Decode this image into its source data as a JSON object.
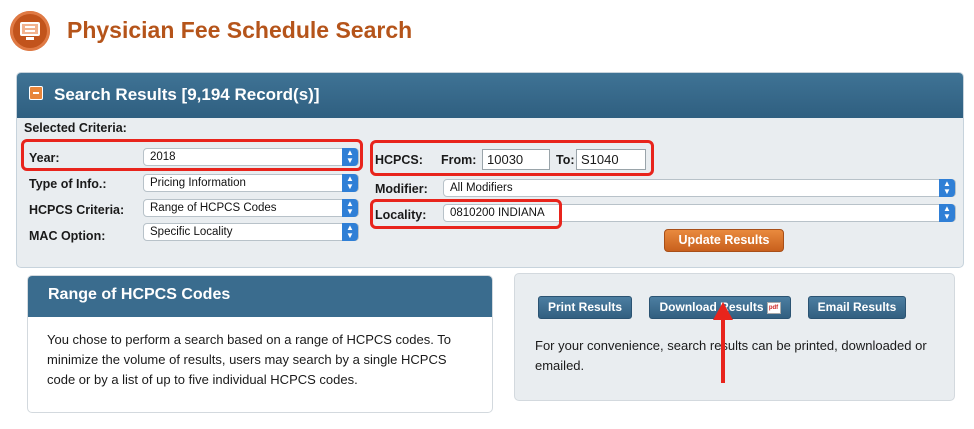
{
  "header": {
    "title": "Physician Fee Schedule Search",
    "logo_icon": "monitor-icon",
    "brand_color": "#b5541a"
  },
  "results": {
    "title": "Search Results [9,194 Record(s)]",
    "collapse_icon": "minus-icon",
    "selected_criteria_label": "Selected Criteria:",
    "year_label": "Year:",
    "year_value": "2018",
    "type_label": "Type of Info.:",
    "type_value": "Pricing Information",
    "hcpcs_criteria_label": "HCPCS Criteria:",
    "hcpcs_criteria_value": "Range of HCPCS Codes",
    "mac_label": "MAC Option:",
    "mac_value": "Specific Locality",
    "hcpcs_label": "HCPCS:",
    "from_label": "From:",
    "from_value": "10030",
    "to_label": "To:",
    "to_value": "S1040",
    "modifier_label": "Modifier:",
    "modifier_value": "All Modifiers",
    "locality_label": "Locality:",
    "locality_value": "0810200 INDIANA",
    "update_button": "Update Results",
    "highlight_color": "#e8241c"
  },
  "info": {
    "title": "Range of HCPCS Codes",
    "text": "You chose to perform a search based on a range of HCPCS codes. To minimize the volume of results, users may search by a single HCPCS code or by a list of up to five individual HCPCS codes."
  },
  "actions": {
    "print_button": "Print Results",
    "download_button": "Download Results",
    "download_icon": "pdf",
    "email_button": "Email Results",
    "text": "For your convenience, search results can be printed, downloaded or emailed."
  }
}
